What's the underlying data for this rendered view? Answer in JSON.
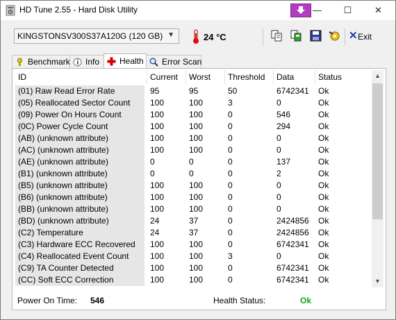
{
  "window": {
    "title": "HD Tune 2.55 - Hard Disk Utility",
    "minimize": "—",
    "maximize": "☐",
    "close": "✕"
  },
  "toolbar": {
    "drive": "KINGSTONSV300S37A120G (120 GB)",
    "temperature": "24 °C",
    "exit_label": "Exit"
  },
  "tabs": [
    {
      "label": "Benchmark",
      "icon": "benchmark-icon"
    },
    {
      "label": "Info",
      "icon": "info-icon"
    },
    {
      "label": "Health",
      "icon": "health-cross-icon",
      "active": true
    },
    {
      "label": "Error Scan",
      "icon": "magnifier-icon"
    }
  ],
  "table": {
    "columns": [
      "ID",
      "Current",
      "Worst",
      "Threshold",
      "Data",
      "Status"
    ],
    "rows": [
      [
        "(01) Raw Read Error Rate",
        "95",
        "95",
        "50",
        "6742341",
        "Ok"
      ],
      [
        "(05) Reallocated Sector Count",
        "100",
        "100",
        "3",
        "0",
        "Ok"
      ],
      [
        "(09) Power On Hours Count",
        "100",
        "100",
        "0",
        "546",
        "Ok"
      ],
      [
        "(0C) Power Cycle Count",
        "100",
        "100",
        "0",
        "294",
        "Ok"
      ],
      [
        "(AB) (unknown attribute)",
        "100",
        "100",
        "0",
        "0",
        "Ok"
      ],
      [
        "(AC) (unknown attribute)",
        "100",
        "100",
        "0",
        "0",
        "Ok"
      ],
      [
        "(AE) (unknown attribute)",
        "0",
        "0",
        "0",
        "137",
        "Ok"
      ],
      [
        "(B1) (unknown attribute)",
        "0",
        "0",
        "0",
        "2",
        "Ok"
      ],
      [
        "(B5) (unknown attribute)",
        "100",
        "100",
        "0",
        "0",
        "Ok"
      ],
      [
        "(B6) (unknown attribute)",
        "100",
        "100",
        "0",
        "0",
        "Ok"
      ],
      [
        "(BB) (unknown attribute)",
        "100",
        "100",
        "0",
        "0",
        "Ok"
      ],
      [
        "(BD) (unknown attribute)",
        "24",
        "37",
        "0",
        "2424856",
        "Ok"
      ],
      [
        "(C2) Temperature",
        "24",
        "37",
        "0",
        "2424856",
        "Ok"
      ],
      [
        "(C3) Hardware ECC Recovered",
        "100",
        "100",
        "0",
        "6742341",
        "Ok"
      ],
      [
        "(C4) Reallocated Event Count",
        "100",
        "100",
        "3",
        "0",
        "Ok"
      ],
      [
        "(C9) TA Counter Detected",
        "100",
        "100",
        "0",
        "6742341",
        "Ok"
      ],
      [
        "(CC) Soft ECC Correction",
        "100",
        "100",
        "0",
        "6742341",
        "Ok"
      ]
    ]
  },
  "status": {
    "power_on_label": "Power On Time:",
    "power_on_value": "546",
    "health_label": "Health Status:",
    "health_value": "Ok"
  },
  "colors": {
    "health_ok": "#16a316",
    "id_column_bg": "#e6e6e6",
    "special_button": "#b23cc4"
  }
}
